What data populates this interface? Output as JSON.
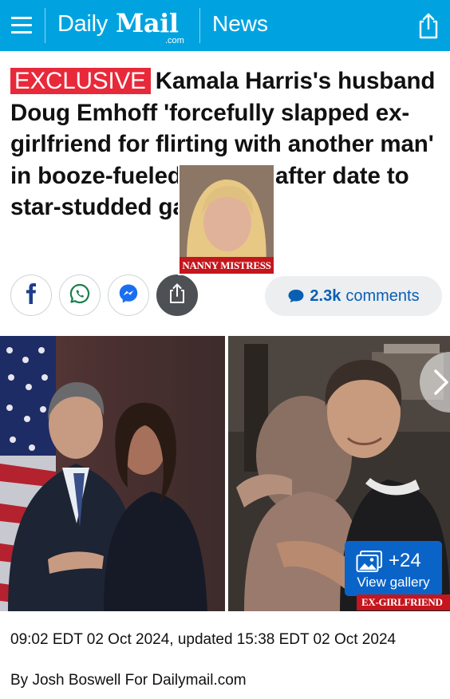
{
  "header": {
    "logo_daily": "Daily",
    "logo_mail": "Mail",
    "logo_com": ".com",
    "section": "News",
    "icons": [
      "menu-icon",
      "share-icon"
    ]
  },
  "article": {
    "badge": "EXCLUSIVE",
    "headline": "Kamala Harris's husband Doug Emhoff 'forcefully slapped ex-girlfriend for flirting with another man' in booze-fueled assault after date to star-studded gala",
    "comments_count": "2.3k",
    "comments_label": "comments",
    "share_icons": [
      "facebook-icon",
      "whatsapp-icon",
      "messenger-icon",
      "share-icon"
    ],
    "image": {
      "inset_caption": "NANNY MISTRESS",
      "right_caption": "EX-GIRLFRIEND",
      "gallery_count": "+24",
      "gallery_label": "View gallery"
    },
    "date": "09:02 EDT 02 Oct 2024, updated 15:38 EDT 02 Oct 2024",
    "byline": "By Josh Boswell For Dailymail.com"
  },
  "colors": {
    "header_bg": "#00a3e0",
    "exclusive_bg": "#e8293a",
    "link": "#0a5fb4",
    "gallery_bg": "#0a64c8",
    "caption_red": "#c4161c"
  }
}
